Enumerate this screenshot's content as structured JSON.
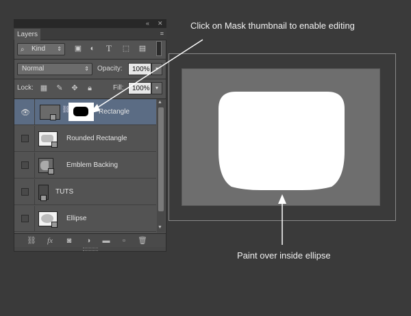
{
  "panel": {
    "tab_label": "Layers",
    "collapse_glyph": "«",
    "close_glyph": "✕",
    "menu_glyph": "≡",
    "filter": {
      "kind_label": "Kind",
      "icons": [
        "image-filter-icon",
        "adjustment-filter-icon",
        "type-filter-icon",
        "shape-filter-icon",
        "smart-object-filter-icon"
      ]
    },
    "blend_mode": "Normal",
    "opacity_label": "Opacity:",
    "opacity_value": "100%",
    "lock_label": "Lock:",
    "fill_label": "Fill:",
    "fill_value": "100%",
    "layers": [
      {
        "name": "Rectangle",
        "visible": true,
        "selected": true
      },
      {
        "name": "Rounded Rectangle",
        "visible": false,
        "selected": false
      },
      {
        "name": "Emblem Backing",
        "visible": false,
        "selected": false
      },
      {
        "name": "TUTS",
        "visible": false,
        "selected": false
      },
      {
        "name": "Ellipse",
        "visible": false,
        "selected": false
      }
    ],
    "footer_icons": [
      "link-icon",
      "fx-icon",
      "add-mask-icon",
      "adjustment-layer-icon",
      "folder-icon",
      "new-layer-icon",
      "trash-icon"
    ],
    "fx_label": "fx"
  },
  "annotations": {
    "top_text": "Click on Mask thumbnail to enable editing",
    "bottom_text": "Paint over inside ellipse"
  },
  "colors": {
    "panel_bg": "#535353",
    "selected_row": "#5b6c84",
    "canvas": "#6e6e6e",
    "shape_fill": "#ffffff",
    "background": "#3a3a3a"
  }
}
